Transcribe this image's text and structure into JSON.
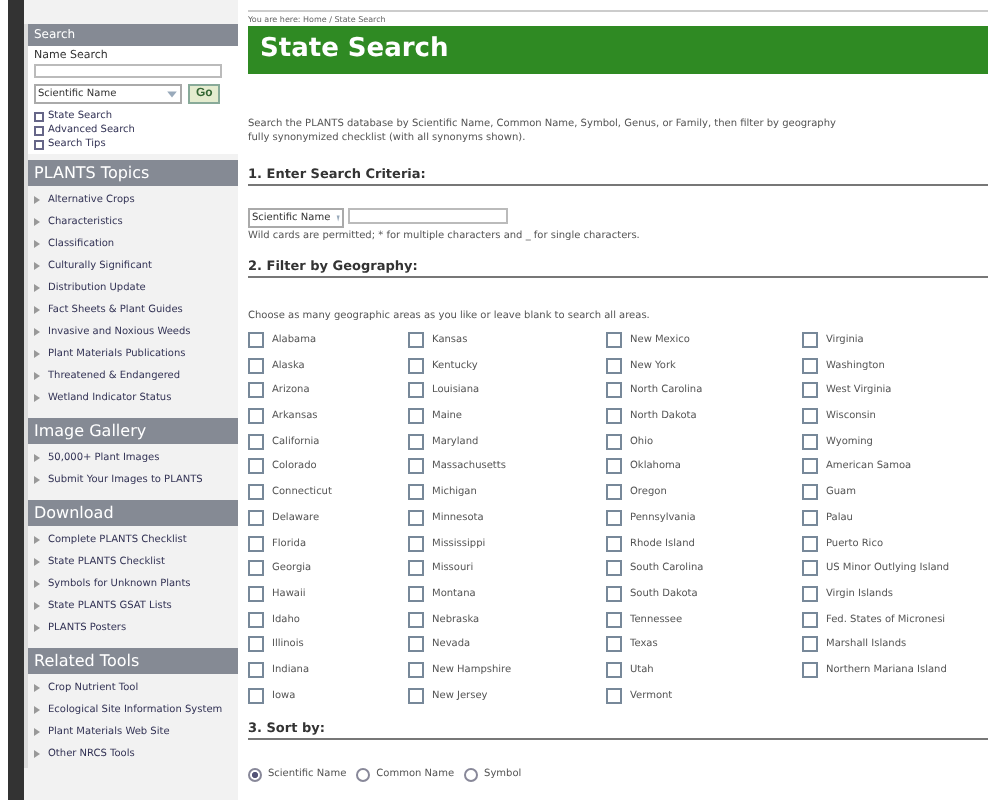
{
  "sidebar": {
    "search": {
      "title": "Search",
      "label": "Name Search",
      "select": "Scientific Name",
      "go": "Go",
      "links": [
        "State Search",
        "Advanced Search",
        "Search Tips"
      ]
    },
    "sections": [
      {
        "title": "PLANTS Topics",
        "items": [
          "Alternative Crops",
          "Characteristics",
          "Classification",
          "Culturally Significant",
          "Distribution Update",
          "Fact Sheets & Plant Guides",
          "Invasive and Noxious Weeds",
          "Plant Materials Publications",
          "Threatened & Endangered",
          "Wetland Indicator Status"
        ]
      },
      {
        "title": "Image Gallery",
        "items": [
          "50,000+ Plant Images",
          "Submit Your Images to PLANTS"
        ]
      },
      {
        "title": "Download",
        "items": [
          "Complete PLANTS Checklist",
          "State PLANTS Checklist",
          "Symbols for Unknown Plants",
          "State PLANTS GSAT Lists",
          "PLANTS Posters"
        ]
      },
      {
        "title": "Related Tools",
        "items": [
          "Crop Nutrient Tool",
          "Ecological Site Information System",
          "Plant Materials Web Site",
          "Other NRCS Tools"
        ]
      }
    ]
  },
  "breadcrumb": "You are here: Home / State Search",
  "title": "State Search",
  "intro": "Search the PLANTS database by Scientific Name, Common Name, Symbol, Genus, or Family, then filter by geography",
  "intro_2": "fully synonymized checklist (with all synonyms shown).",
  "step_1": {
    "heading": "1. Enter Search Criteria:",
    "select": "Scientific Name",
    "hint": "Wild cards are permitted; * for multiple characters and _ for single characters."
  },
  "step_2": {
    "heading": "2. Filter by Geography:",
    "hint": "Choose as many geographic areas as you like or leave blank to search all areas.",
    "columns": [
      [
        {
          "label": "Alabama",
          "checked": false
        },
        {
          "label": "Alaska",
          "checked": false
        },
        {
          "label": "Arizona",
          "checked": false
        },
        {
          "label": "Arkansas",
          "checked": false
        },
        {
          "label": "California",
          "checked": false
        },
        {
          "label": "Colorado",
          "checked": false
        },
        {
          "label": "Connecticut",
          "checked": false
        },
        {
          "label": "Delaware",
          "checked": false
        },
        {
          "label": "Florida",
          "checked": false
        },
        {
          "label": "Georgia",
          "checked": false
        },
        {
          "label": "Hawaii",
          "checked": false
        },
        {
          "label": "Idaho",
          "checked": false
        },
        {
          "label": "Illinois",
          "checked": false
        },
        {
          "label": "Indiana",
          "checked": false
        },
        {
          "label": "Iowa",
          "checked": false
        }
      ],
      [
        {
          "label": "Kansas",
          "checked": false
        },
        {
          "label": "Kentucky",
          "checked": false
        },
        {
          "label": "Louisiana",
          "checked": false
        },
        {
          "label": "Maine",
          "checked": false
        },
        {
          "label": "Maryland",
          "checked": false
        },
        {
          "label": "Massachusetts",
          "checked": false
        },
        {
          "label": "Michigan",
          "checked": false
        },
        {
          "label": "Minnesota",
          "checked": false
        },
        {
          "label": "Mississippi",
          "checked": false
        },
        {
          "label": "Missouri",
          "checked": false
        },
        {
          "label": "Montana",
          "checked": false
        },
        {
          "label": "Nebraska",
          "checked": false
        },
        {
          "label": "Nevada",
          "checked": false
        },
        {
          "label": "New Hampshire",
          "checked": false
        },
        {
          "label": "New Jersey",
          "checked": false
        }
      ],
      [
        {
          "label": "New Mexico",
          "checked": false
        },
        {
          "label": "New York",
          "checked": false
        },
        {
          "label": "North Carolina",
          "checked": false
        },
        {
          "label": "North Dakota",
          "checked": false
        },
        {
          "label": "Ohio",
          "checked": false
        },
        {
          "label": "Oklahoma",
          "checked": false
        },
        {
          "label": "Oregon",
          "checked": false
        },
        {
          "label": "Pennsylvania",
          "checked": false
        },
        {
          "label": "Rhode Island",
          "checked": false
        },
        {
          "label": "South Carolina",
          "checked": false
        },
        {
          "label": "South Dakota",
          "checked": false
        },
        {
          "label": "Tennessee",
          "checked": false
        },
        {
          "label": "Texas",
          "checked": false
        },
        {
          "label": "Utah",
          "checked": false
        },
        {
          "label": "Vermont",
          "checked": false
        }
      ],
      [
        {
          "label": "Virginia",
          "checked": false
        },
        {
          "label": "Washington",
          "checked": false
        },
        {
          "label": "West Virginia",
          "checked": false
        },
        {
          "label": "Wisconsin",
          "checked": false
        },
        {
          "label": "Wyoming",
          "checked": false
        },
        {
          "label": "American Samoa",
          "checked": false
        },
        {
          "label": "Guam",
          "checked": false
        },
        {
          "label": "Palau",
          "checked": false
        },
        {
          "label": "Puerto Rico",
          "checked": false
        },
        {
          "label": "US Minor Outlying Island",
          "checked": false
        },
        {
          "label": "Virgin Islands",
          "checked": false
        },
        {
          "label": "Fed. States of Micronesi",
          "checked": false
        },
        {
          "label": "Marshall Islands",
          "checked": false
        },
        {
          "label": "Northern Mariana Island",
          "checked": false
        }
      ]
    ]
  },
  "step_3": {
    "heading": "3. Sort by:",
    "options": [
      {
        "label": "Scientific Name",
        "selected": true
      },
      {
        "label": "Common Name",
        "selected": false
      },
      {
        "label": "Symbol",
        "selected": false
      }
    ]
  }
}
